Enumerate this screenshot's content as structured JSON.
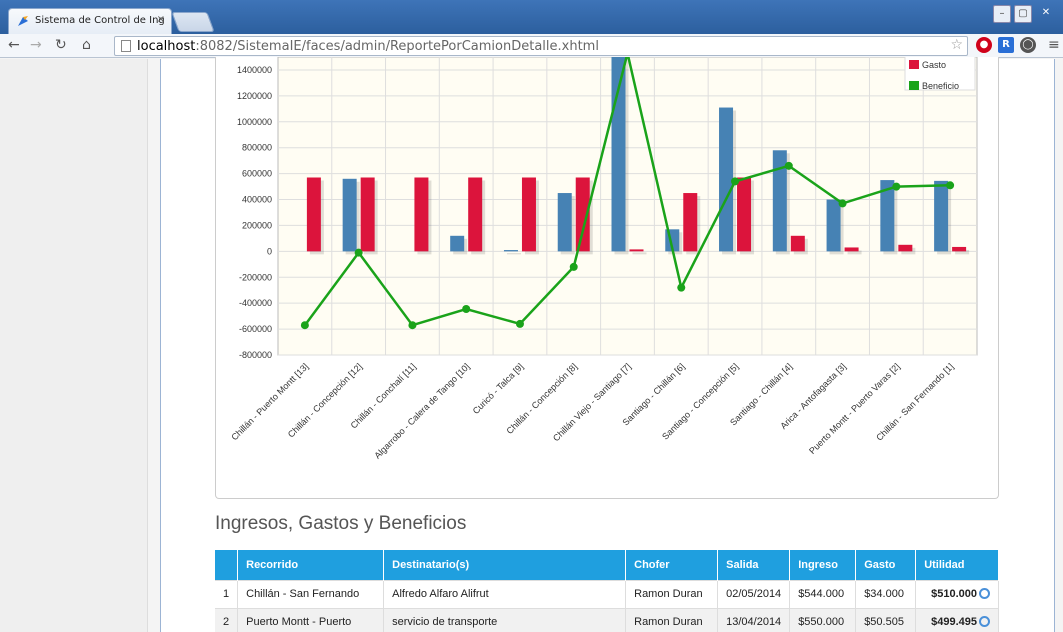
{
  "browser": {
    "tab_title": "Sistema de Control de Ing",
    "tab_close": "×",
    "url_host": "localhost",
    "url_rest": ":8082/SistemaIE/faces/admin/ReportePorCamionDetalle.xhtml",
    "win_min": "–",
    "win_max": "▢",
    "win_close": "✕"
  },
  "chart_data": {
    "type": "bar",
    "categories": [
      "Chillán - Puerto Montt [13]",
      "Chillán - Concepción [12]",
      "Chillán - Conchalí [11]",
      "Algarrobo - Calera de Tango [10]",
      "Curicó - Talca [9]",
      "Chillán - Concepción [8]",
      "Chillán Viejo - Santiago [7]",
      "Santiago - Chillán [6]",
      "Santiago - Concepción [5]",
      "Santiago - Chillán [4]",
      "Arica - Antofagasta [3]",
      "Puerto Montt - Puerto Varas [2]",
      "Chillán - San Fernando [1]"
    ],
    "series": [
      {
        "name": "",
        "kind": "bar",
        "color": "#4682b4",
        "values": [
          0,
          560000,
          0,
          120000,
          10000,
          450000,
          1550000,
          170000,
          1110000,
          780000,
          400000,
          550000,
          544000
        ]
      },
      {
        "name": "Gasto",
        "kind": "bar",
        "color": "#dc143c",
        "values": [
          570000,
          570000,
          570000,
          570000,
          570000,
          570000,
          15000,
          450000,
          570000,
          120000,
          30000,
          50505,
          34000
        ]
      },
      {
        "name": "Beneficio",
        "kind": "line",
        "color": "#1aa31a",
        "values": [
          -570000,
          -10000,
          -570000,
          -445000,
          -560000,
          -120000,
          1530000,
          -280000,
          540000,
          660000,
          370000,
          499495,
          510000
        ]
      }
    ],
    "yticks": [
      "1400000",
      "1200000",
      "1000000",
      "800000",
      "600000",
      "400000",
      "200000",
      "0",
      "-200000",
      "-400000",
      "-600000",
      "-800000"
    ],
    "ylim": [
      -800000,
      1500000
    ],
    "legend_position": "top-right",
    "grid": true
  },
  "section_title": "Ingresos, Gastos y Beneficios",
  "table": {
    "headers": [
      "",
      "Recorrido",
      "Destinatario(s)",
      "Chofer",
      "Salida",
      "Ingreso",
      "Gasto",
      "Utilidad"
    ],
    "rows": [
      {
        "n": "1",
        "recorrido": "Chillán - San Fernando",
        "dest": "Alfredo Alfaro Alifrut",
        "chofer": "Ramon Duran",
        "salida": "02/05/2014",
        "ingreso": "$544.000",
        "gasto": "$34.000",
        "utilidad": "$510.000"
      },
      {
        "n": "2",
        "recorrido": "Puerto Montt - Puerto",
        "dest": "servicio de transporte",
        "chofer": "Ramon Duran",
        "salida": "13/04/2014",
        "ingreso": "$550.000",
        "gasto": "$50.505",
        "utilidad": "$499.495"
      }
    ]
  }
}
